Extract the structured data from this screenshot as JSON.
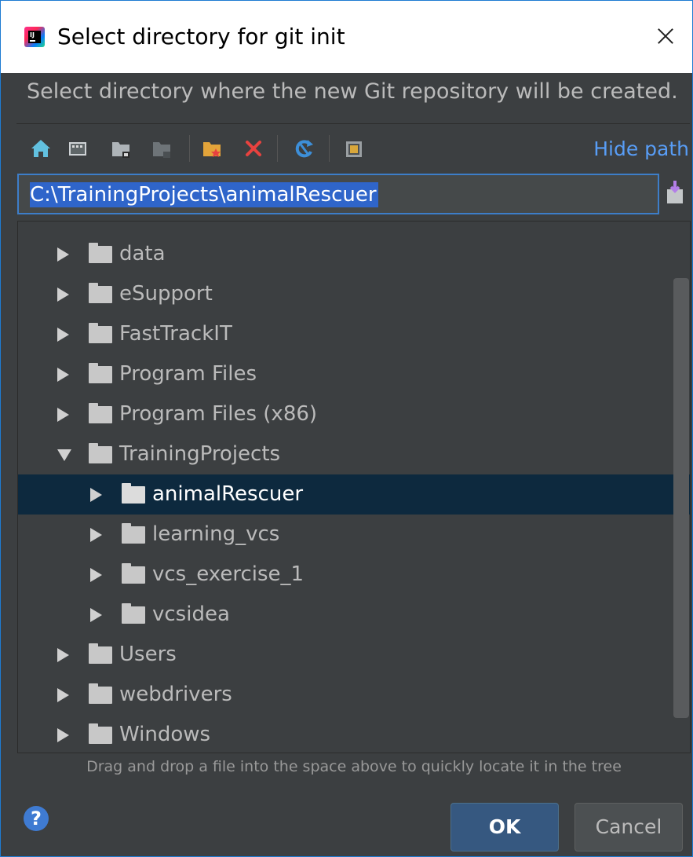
{
  "window": {
    "title": "Select directory for git init",
    "description": "Select directory where the new Git repository will be created."
  },
  "toolbar": {
    "icons": [
      "home-icon",
      "desktop-icon",
      "project-folder-icon",
      "module-folder-icon",
      "new-folder-icon",
      "delete-icon",
      "refresh-icon",
      "show-hidden-icon"
    ],
    "hide_path_label": "Hide path"
  },
  "path": {
    "value": "C:\\TrainingProjects\\animalRescuer"
  },
  "tree": {
    "items": [
      {
        "label": "data",
        "level": 0,
        "expanded": false,
        "selected": false
      },
      {
        "label": "eSupport",
        "level": 0,
        "expanded": false,
        "selected": false
      },
      {
        "label": "FastTrackIT",
        "level": 0,
        "expanded": false,
        "selected": false
      },
      {
        "label": "Program Files",
        "level": 0,
        "expanded": false,
        "selected": false
      },
      {
        "label": "Program Files (x86)",
        "level": 0,
        "expanded": false,
        "selected": false
      },
      {
        "label": "TrainingProjects",
        "level": 0,
        "expanded": true,
        "selected": false
      },
      {
        "label": "animalRescuer",
        "level": 1,
        "expanded": false,
        "selected": true
      },
      {
        "label": "learning_vcs",
        "level": 1,
        "expanded": false,
        "selected": false
      },
      {
        "label": "vcs_exercise_1",
        "level": 1,
        "expanded": false,
        "selected": false
      },
      {
        "label": "vcsidea",
        "level": 1,
        "expanded": false,
        "selected": false
      },
      {
        "label": "Users",
        "level": 0,
        "expanded": false,
        "selected": false
      },
      {
        "label": "webdrivers",
        "level": 0,
        "expanded": false,
        "selected": false
      },
      {
        "label": "Windows",
        "level": 0,
        "expanded": false,
        "selected": false
      }
    ]
  },
  "hint": "Drag and drop a file into the space above to quickly locate it in the tree",
  "buttons": {
    "help": "?",
    "ok": "OK",
    "cancel": "Cancel"
  },
  "colors": {
    "accent": "#589df6",
    "selection": "#0d293e",
    "background": "#3c3f41",
    "path_highlight": "#2f65ca"
  }
}
